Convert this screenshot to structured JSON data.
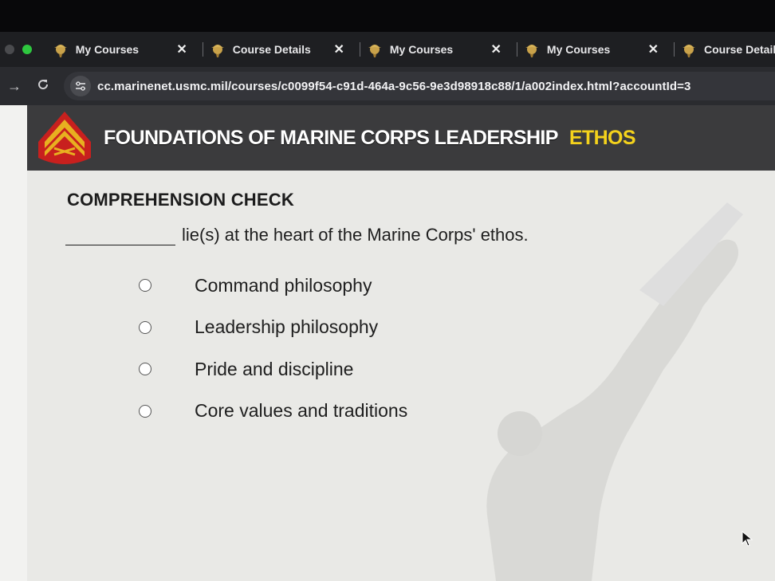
{
  "browser": {
    "tabs": [
      {
        "title": "My Courses",
        "close": "✕"
      },
      {
        "title": "Course Details",
        "close": "✕"
      },
      {
        "title": "My Courses",
        "close": "✕"
      },
      {
        "title": "My Courses",
        "close": "✕"
      },
      {
        "title": "Course Details",
        "close": ""
      }
    ],
    "url": "cc.marinenet.usmc.mil/courses/c0099f54-c91d-464a-9c56-9e3d98918c88/1/a002index.html?accountId=3"
  },
  "banner": {
    "title": "FOUNDATIONS OF MARINE CORPS LEADERSHIP",
    "tag": "ETHOS"
  },
  "quiz": {
    "heading": "COMPREHENSION CHECK",
    "question": "lie(s) at the heart of the Marine Corps' ethos.",
    "options": [
      {
        "label": "Command philosophy",
        "selected": false
      },
      {
        "label": "Leadership philosophy",
        "selected": false
      },
      {
        "label": "Pride and discipline",
        "selected": false
      },
      {
        "label": "Core values and traditions",
        "selected": false
      }
    ]
  },
  "colors": {
    "banner_bg": "#3b3b3d",
    "tag": "#f4d21c",
    "emblem_red": "#c8201e",
    "emblem_gold": "#e8b020"
  }
}
